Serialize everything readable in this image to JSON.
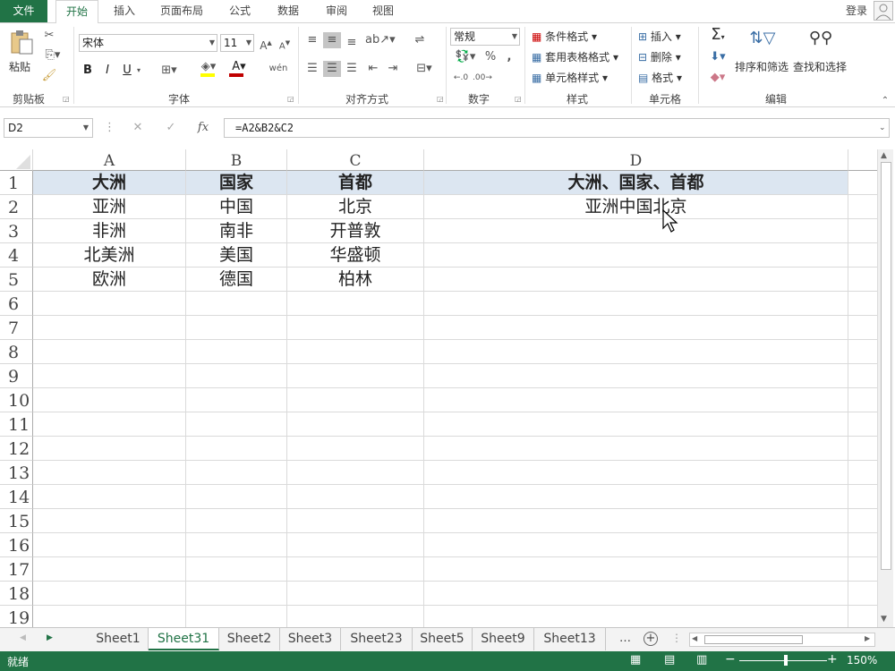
{
  "ribbon_tabs": [
    "文件",
    "开始",
    "插入",
    "页面布局",
    "公式",
    "数据",
    "审阅",
    "视图"
  ],
  "login": "登录",
  "clipboard": {
    "paste": "粘贴",
    "label": "剪贴板"
  },
  "font": {
    "name": "宋体",
    "size": "11",
    "label": "字体",
    "bold": "B",
    "italic": "I",
    "underline": "U",
    "wen": "wén"
  },
  "alignment": {
    "label": "对齐方式"
  },
  "number": {
    "format": "常规",
    "label": "数字",
    "percent": "%",
    "comma": ","
  },
  "styles": {
    "conditional": "条件格式",
    "table": "套用表格格式",
    "cell": "单元格样式",
    "label": "样式"
  },
  "cells": {
    "insert": "插入",
    "delete": "删除",
    "format": "格式",
    "label": "单元格"
  },
  "editing": {
    "sort": "排序和筛选",
    "find": "查找和选择",
    "label": "编辑"
  },
  "formula_bar": {
    "name_box": "D2",
    "formula": "=A2&B2&C2",
    "fx": "fx"
  },
  "columns": [
    "A",
    "B",
    "C",
    "D"
  ],
  "rows": [
    "1",
    "2",
    "3",
    "4",
    "5",
    "6",
    "7",
    "8",
    "9",
    "10",
    "11",
    "12",
    "13",
    "14",
    "15",
    "16",
    "17",
    "18",
    "19"
  ],
  "cells_data": [
    [
      "大洲",
      "国家",
      "首都",
      "大洲、国家、首都"
    ],
    [
      "亚洲",
      "中国",
      "北京",
      "亚洲中国北京"
    ],
    [
      "非洲",
      "南非",
      "开普敦",
      ""
    ],
    [
      "北美洲",
      "美国",
      "华盛顿",
      ""
    ],
    [
      "欧洲",
      "德国",
      "柏林",
      ""
    ]
  ],
  "sheets": [
    "Sheet1",
    "Sheet31",
    "Sheet2",
    "Sheet3",
    "Sheet23",
    "Sheet5",
    "Sheet9",
    "Sheet13"
  ],
  "active_sheet": "Sheet31",
  "status": {
    "ready": "就绪",
    "zoom": "150%"
  },
  "colors": {
    "accent": "#217346",
    "header_fill": "#dce6f1"
  }
}
